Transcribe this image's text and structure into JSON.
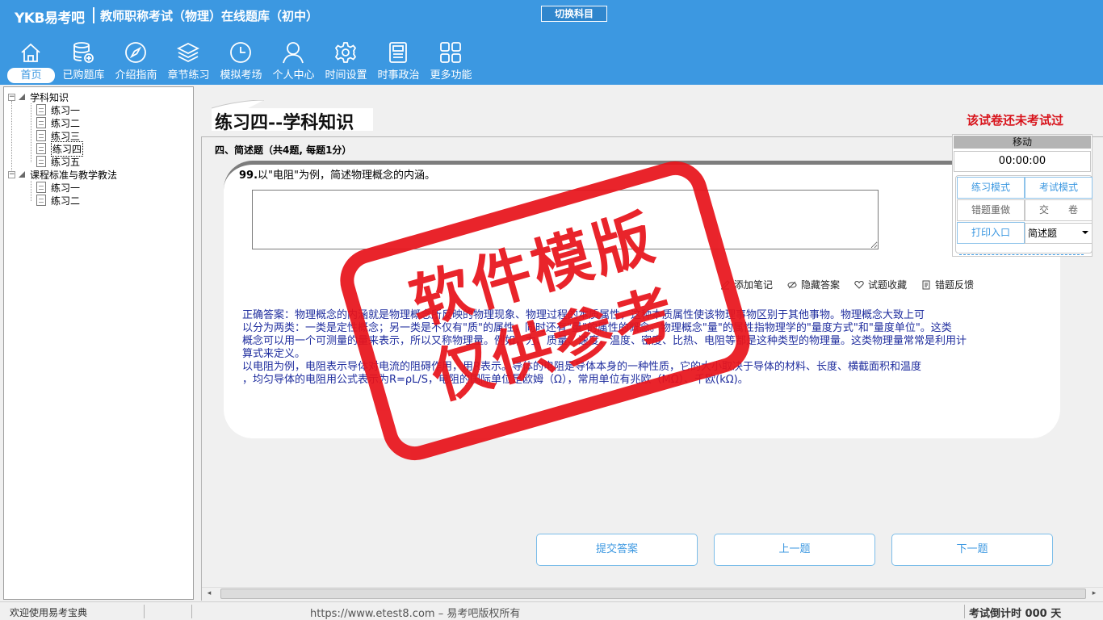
{
  "header": {
    "logo": "YKB易考吧",
    "app_title": "教师职称考试（物理）在线题库（初中）",
    "switch_subject": "切换科目",
    "nav": [
      {
        "label": "首页",
        "icon": "home-icon",
        "active": true
      },
      {
        "label": "已购题库",
        "icon": "database-icon",
        "active": false
      },
      {
        "label": "介绍指南",
        "icon": "compass-icon",
        "active": false
      },
      {
        "label": "章节练习",
        "icon": "layers-icon",
        "active": false
      },
      {
        "label": "模拟考场",
        "icon": "clock-icon",
        "active": false
      },
      {
        "label": "个人中心",
        "icon": "user-icon",
        "active": false
      },
      {
        "label": "时间设置",
        "icon": "gear-icon",
        "active": false
      },
      {
        "label": "时事政治",
        "icon": "news-icon",
        "active": false
      },
      {
        "label": "更多功能",
        "icon": "grid-icon",
        "active": false
      }
    ]
  },
  "tree": {
    "group1": {
      "label": "学科知识",
      "items": [
        "练习一",
        "练习二",
        "练习三",
        "练习四",
        "练习五"
      ],
      "selected_index": 3
    },
    "group2": {
      "label": "课程标准与教学教法",
      "items": [
        "练习一",
        "练习二"
      ]
    }
  },
  "main": {
    "exercise_title": "练习四--学科知识",
    "exam_status": "该试卷还未考试过",
    "section_header": "四、简述题（共4题, 每题1分）",
    "question_number": "99.",
    "question_text": "以\"电阻\"为例，简述物理概念的内涵。",
    "answer_value": "",
    "toolbar": {
      "add_note": "添加笔记",
      "hide_answer": "隐藏答案",
      "favorite": "试题收藏",
      "feedback": "错题反馈"
    },
    "answer_lines": [
      "正确答案：物理概念的内涵就是物理概念所反映的物理现象、物理过程的本质属性，这种本质属性使该物理事物区别于其他事物。物理概念大致上可",
      "以分为两类：一类是定性概念；另一类是不仅有\"质\"的属性，同时还有\"量\"的属性的概念。物理概念\"量\"的属性指物理学的\"量度方式\"和\"量度单位\"。这类",
      "概念可以用一个可测量的量来表示，所以又称物理量。例如，力、质量、速度、温度、密度、比热、电阻等都是这种类型的物理量。这类物理量常常是利用计",
      "算式来定义。",
      "以电阻为例，电阻表示导体对电流的阻碍作用，用R表示。导体的电阻是导体本身的一种性质，它的大小取决于导体的材料、长度、横截面积和温度",
      "，均匀导体的电阻用公式表示为R=ρL/S，电阻的国际单位是欧姆（Ω），常用单位有兆欧（MΩ）、千欧(kΩ)。"
    ],
    "buttons": {
      "submit": "提交答案",
      "prev": "上一题",
      "next": "下一题"
    }
  },
  "watermark": {
    "line1": "软件模版",
    "line2": "仅供参考"
  },
  "timer": {
    "move_label": "移动",
    "time": "00:00:00",
    "practice_mode": "练习模式",
    "exam_mode": "考试模式",
    "redo_wrong": "错题重做",
    "hand_in": "交　　卷",
    "print_entry": "打印入口",
    "question_type": "简述题"
  },
  "statusbar": {
    "welcome": "欢迎使用易考宝典",
    "copyright": "https://www.etest8.com – 易考吧版权所有",
    "countdown": "考试倒计时 000 天"
  }
}
